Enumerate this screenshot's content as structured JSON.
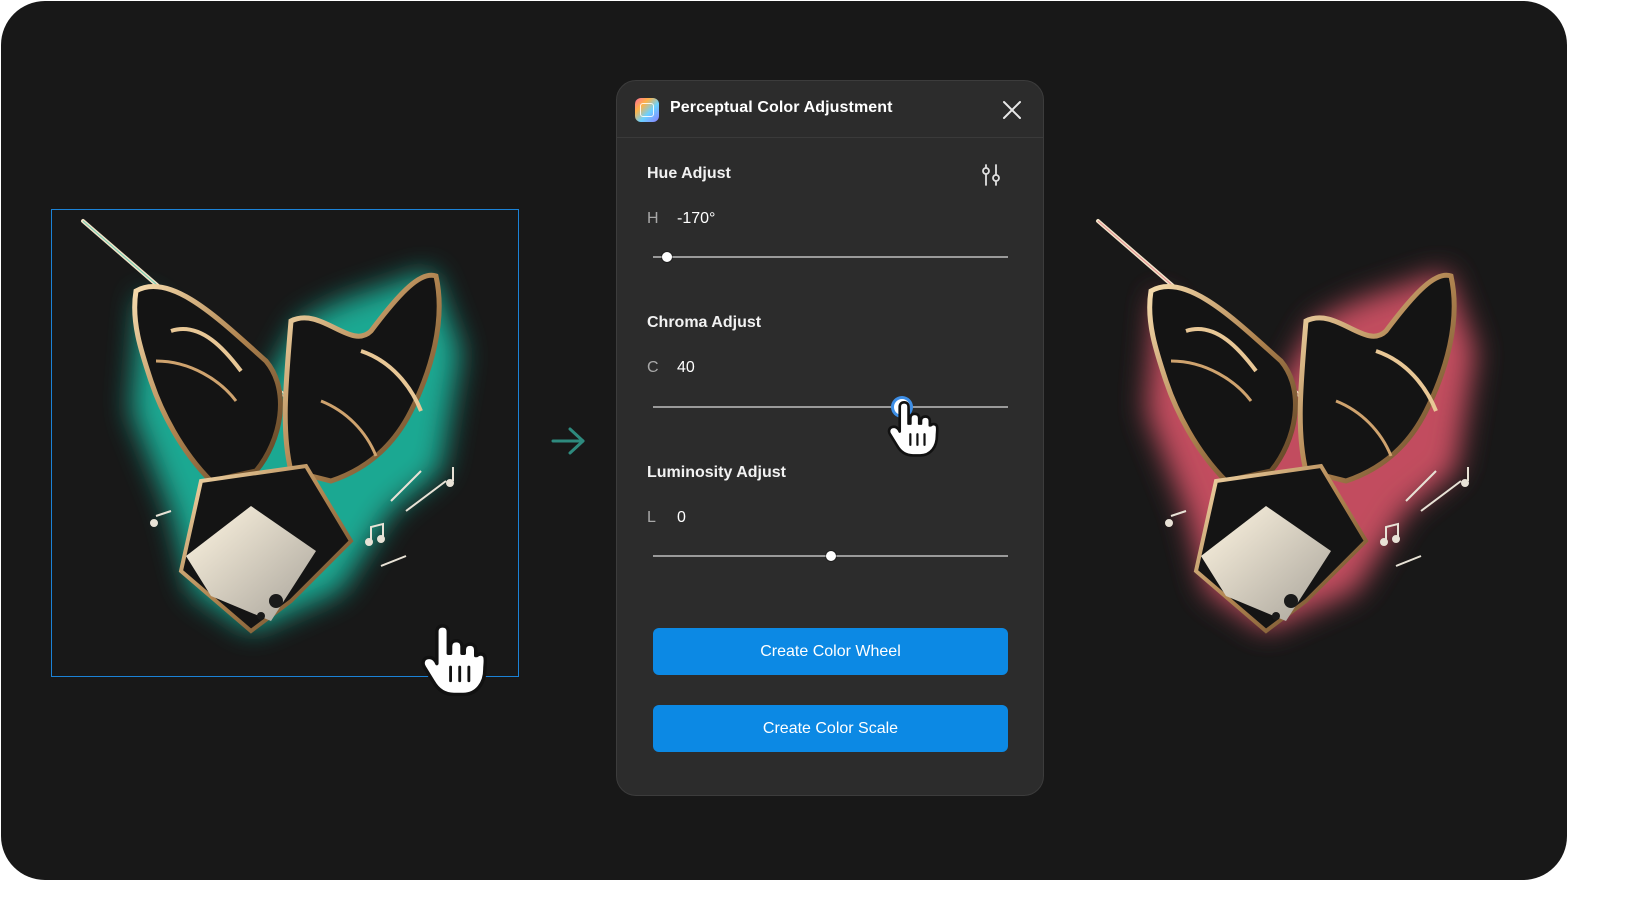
{
  "panel": {
    "title": "Perceptual Color Adjustment",
    "icons": {
      "app": "app-icon",
      "close": "close-icon",
      "settings": "tune-sliders-icon"
    }
  },
  "hue": {
    "title": "Hue Adjust",
    "prefix": "H",
    "value": "-170°",
    "slider_fraction": 0.04
  },
  "chroma": {
    "title": "Chroma Adjust",
    "prefix": "C",
    "value": "40",
    "slider_fraction": 0.7
  },
  "luminosity": {
    "title": "Luminosity Adjust",
    "prefix": "L",
    "value": "0",
    "slider_fraction": 0.5
  },
  "buttons": {
    "color_wheel": "Create Color Wheel",
    "color_scale": "Create Color Scale"
  },
  "colors": {
    "canvas": "#181818",
    "panel": "#2c2c2c",
    "accent": "#0c89e4",
    "selection": "#1b82d6",
    "before_glow": "#1fc2a8",
    "after_glow": "#e0566c"
  },
  "artwork": {
    "before": "conductor-hands-teal-glow",
    "after": "conductor-hands-red-glow",
    "arrow": "arrow-right-icon",
    "cursor": "hand-pointer-icon"
  }
}
